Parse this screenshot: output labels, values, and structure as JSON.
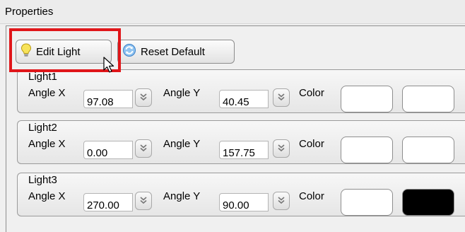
{
  "window": {
    "title": "Properties"
  },
  "toolbar": {
    "edit_light_label": "Edit Light",
    "reset_default_label": "Reset Default"
  },
  "lights": [
    {
      "name": "Light1",
      "angle_x_label": "Angle X",
      "angle_x": "97.08",
      "angle_y_label": "Angle Y",
      "angle_y": "40.45",
      "color_label": "Color",
      "color_1": "#ffffff",
      "color_2": "#ffffff"
    },
    {
      "name": "Light2",
      "angle_x_label": "Angle X",
      "angle_x": "0.00",
      "angle_y_label": "Angle Y",
      "angle_y": "157.75",
      "color_label": "Color",
      "color_1": "#ffffff",
      "color_2": "#ffffff"
    },
    {
      "name": "Light3",
      "angle_x_label": "Angle X",
      "angle_x": "270.00",
      "angle_y_label": "Angle Y",
      "angle_y": "90.00",
      "color_label": "Color",
      "color_1": "#ffffff",
      "color_2": "#000000"
    }
  ],
  "icons": {
    "edit_light": "lightbulb-icon",
    "reset_default": "refresh-icon",
    "spinner": "double-chevron-icon",
    "pointer": "mouse-cursor-icon"
  },
  "highlight_color": "#e0161a"
}
